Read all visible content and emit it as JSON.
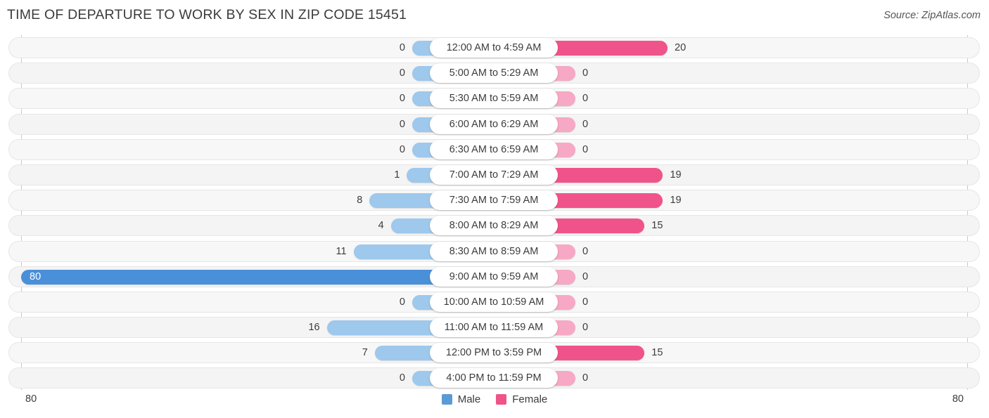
{
  "header": {
    "title": "TIME OF DEPARTURE TO WORK BY SEX IN ZIP CODE 15451",
    "source": "Source: ZipAtlas.com"
  },
  "legend": {
    "male_label": "Male",
    "female_label": "Female",
    "male_color": "#5b9bd5",
    "female_color": "#f0538a"
  },
  "axis": {
    "left_label": "80",
    "right_label": "80"
  },
  "colors": {
    "male_light": "#9ec8ec",
    "male_highlight": "#4a90d9",
    "female_light": "#f7a8c4",
    "female_strong": "#f0538a",
    "track": "#f7f7f7",
    "title": "#3c3c3c"
  },
  "chart_data": {
    "type": "bar",
    "title": "TIME OF DEPARTURE TO WORK BY SEX IN ZIP CODE 15451",
    "subtitle": "Source: ZipAtlas.com",
    "orientation": "horizontal-diverging",
    "xlabel": "",
    "ylabel": "",
    "xlim": [
      80,
      80
    ],
    "grid": false,
    "legend_position": "bottom-center",
    "categories": [
      "12:00 AM to 4:59 AM",
      "5:00 AM to 5:29 AM",
      "5:30 AM to 5:59 AM",
      "6:00 AM to 6:29 AM",
      "6:30 AM to 6:59 AM",
      "7:00 AM to 7:29 AM",
      "7:30 AM to 7:59 AM",
      "8:00 AM to 8:29 AM",
      "8:30 AM to 8:59 AM",
      "9:00 AM to 9:59 AM",
      "10:00 AM to 10:59 AM",
      "11:00 AM to 11:59 AM",
      "12:00 PM to 3:59 PM",
      "4:00 PM to 11:59 PM"
    ],
    "series": [
      {
        "name": "Male",
        "values": [
          0,
          0,
          0,
          0,
          0,
          1,
          8,
          4,
          11,
          80,
          0,
          16,
          7,
          0
        ]
      },
      {
        "name": "Female",
        "values": [
          20,
          0,
          0,
          0,
          0,
          19,
          19,
          15,
          0,
          0,
          0,
          0,
          15,
          0
        ]
      }
    ]
  },
  "rows": [
    {
      "category": "12:00 AM to 4:59 AM",
      "male": "0",
      "female": "20"
    },
    {
      "category": "5:00 AM to 5:29 AM",
      "male": "0",
      "female": "0"
    },
    {
      "category": "5:30 AM to 5:59 AM",
      "male": "0",
      "female": "0"
    },
    {
      "category": "6:00 AM to 6:29 AM",
      "male": "0",
      "female": "0"
    },
    {
      "category": "6:30 AM to 6:59 AM",
      "male": "0",
      "female": "0"
    },
    {
      "category": "7:00 AM to 7:29 AM",
      "male": "1",
      "female": "19"
    },
    {
      "category": "7:30 AM to 7:59 AM",
      "male": "8",
      "female": "19"
    },
    {
      "category": "8:00 AM to 8:29 AM",
      "male": "4",
      "female": "15"
    },
    {
      "category": "8:30 AM to 8:59 AM",
      "male": "11",
      "female": "0"
    },
    {
      "category": "9:00 AM to 9:59 AM",
      "male": "80",
      "female": "0"
    },
    {
      "category": "10:00 AM to 10:59 AM",
      "male": "0",
      "female": "0"
    },
    {
      "category": "11:00 AM to 11:59 AM",
      "male": "16",
      "female": "0"
    },
    {
      "category": "12:00 PM to 3:59 PM",
      "male": "7",
      "female": "15"
    },
    {
      "category": "4:00 PM to 11:59 PM",
      "male": "0",
      "female": "0"
    }
  ]
}
